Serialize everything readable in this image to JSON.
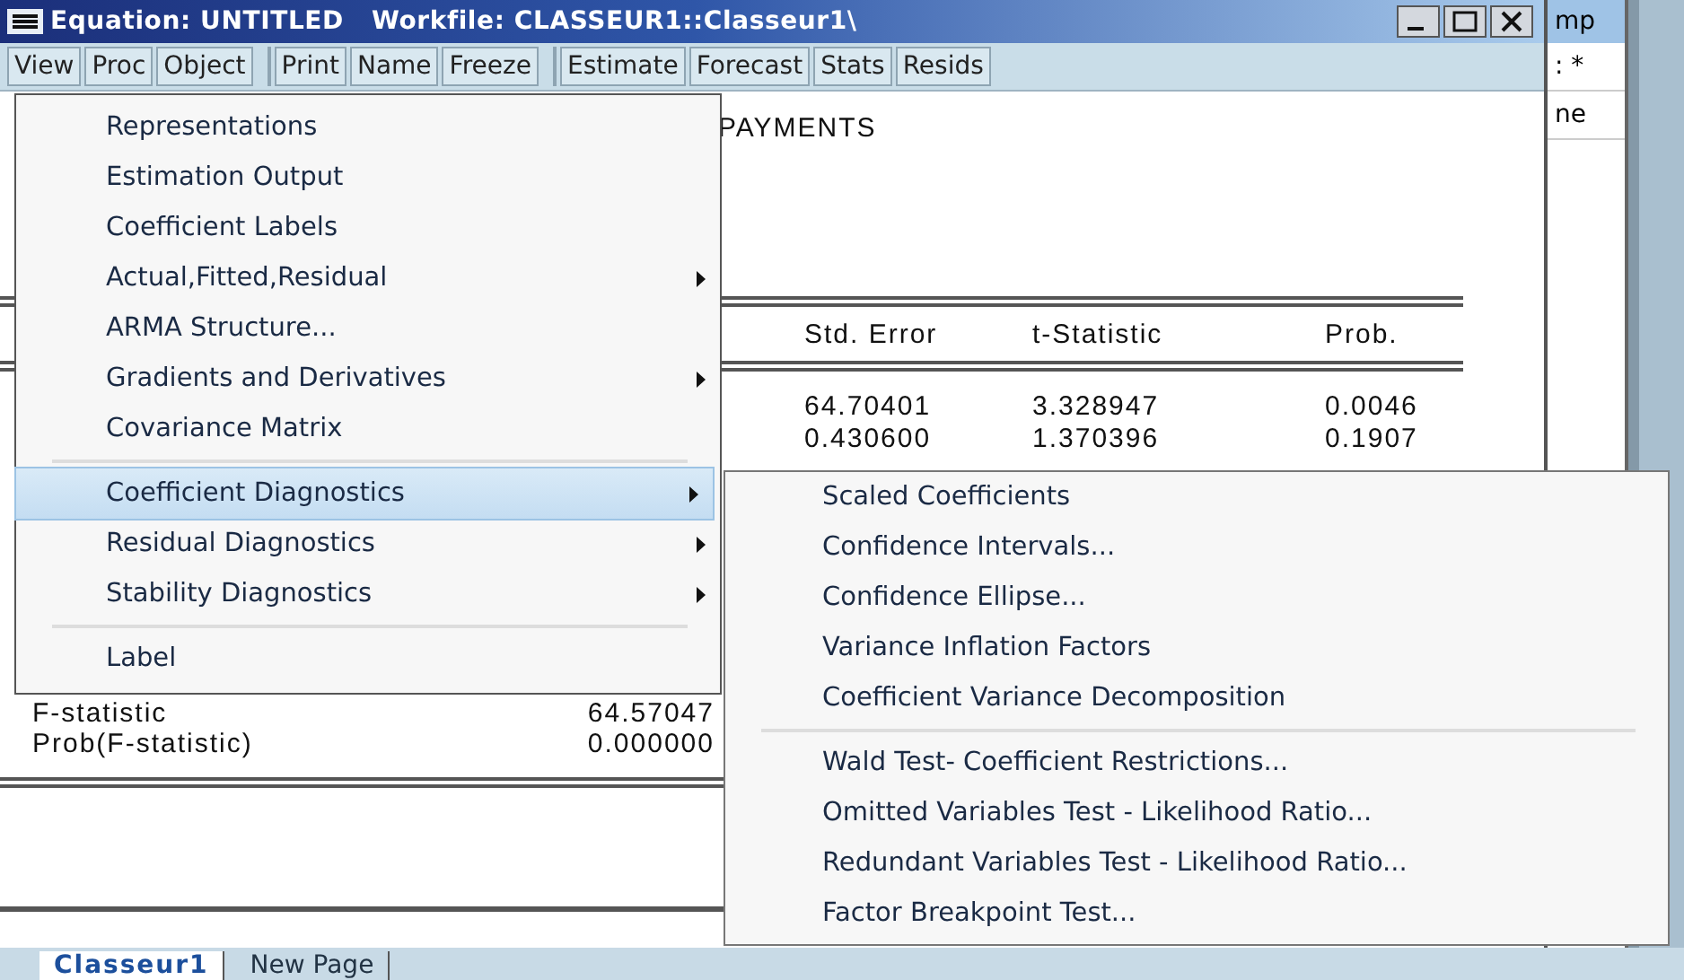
{
  "window": {
    "title": "Equation: UNTITLED   Workfile: CLASSEUR1::Classeur1\\"
  },
  "toolbar": [
    [
      "View",
      "Proc",
      "Object"
    ],
    [
      "Print",
      "Name",
      "Freeze"
    ],
    [
      "Estimate",
      "Forecast",
      "Stats",
      "Resids"
    ]
  ],
  "output": {
    "heading": "PAYMENTS",
    "columns": [
      "Std. Error",
      "t-Statistic",
      "Prob."
    ],
    "rows": [
      [
        "64.70401",
        "3.328947",
        "0.0046"
      ],
      [
        "0.430600",
        "1.370396",
        "0.1907"
      ]
    ],
    "stats": [
      {
        "label": "F-statistic",
        "value": "64.57047"
      },
      {
        "label": "Prob(F-statistic)",
        "value": "0.000000"
      }
    ]
  },
  "view_menu": [
    {
      "kind": "item",
      "label": "Representations",
      "submenu": false,
      "selected": false
    },
    {
      "kind": "item",
      "label": "Estimation Output",
      "submenu": false,
      "selected": false
    },
    {
      "kind": "item",
      "label": "Coefficient Labels",
      "submenu": false,
      "selected": false
    },
    {
      "kind": "item",
      "label": "Actual,Fitted,Residual",
      "submenu": true,
      "selected": false
    },
    {
      "kind": "item",
      "label": "ARMA Structure...",
      "submenu": false,
      "selected": false
    },
    {
      "kind": "item",
      "label": "Gradients and Derivatives",
      "submenu": true,
      "selected": false
    },
    {
      "kind": "item",
      "label": "Covariance Matrix",
      "submenu": false,
      "selected": false
    },
    {
      "kind": "separator"
    },
    {
      "kind": "item",
      "label": "Coefficient Diagnostics",
      "submenu": true,
      "selected": true
    },
    {
      "kind": "item",
      "label": "Residual Diagnostics",
      "submenu": true,
      "selected": false
    },
    {
      "kind": "item",
      "label": "Stability Diagnostics",
      "submenu": true,
      "selected": false
    },
    {
      "kind": "separator"
    },
    {
      "kind": "item",
      "label": "Label",
      "submenu": false,
      "selected": false
    }
  ],
  "submenu": [
    {
      "kind": "item",
      "label": "Scaled Coefficients"
    },
    {
      "kind": "item",
      "label": "Confidence Intervals..."
    },
    {
      "kind": "item",
      "label": "Confidence Ellipse..."
    },
    {
      "kind": "item",
      "label": "Variance Inflation Factors"
    },
    {
      "kind": "item",
      "label": "Coefficient Variance Decomposition"
    },
    {
      "kind": "separator"
    },
    {
      "kind": "item",
      "label": "Wald Test- Coefficient Restrictions..."
    },
    {
      "kind": "item",
      "label": "Omitted Variables Test - Likelihood Ratio..."
    },
    {
      "kind": "item",
      "label": "Redundant Variables Test - Likelihood Ratio..."
    },
    {
      "kind": "item",
      "label": "Factor Breakpoint Test..."
    }
  ],
  "background_window": {
    "title": "mp",
    "lines": [
      ": *",
      "ne"
    ]
  },
  "sheet_tabs": [
    {
      "label": "Classeur1",
      "selected": true
    },
    {
      "label": "New Page",
      "selected": false
    }
  ]
}
